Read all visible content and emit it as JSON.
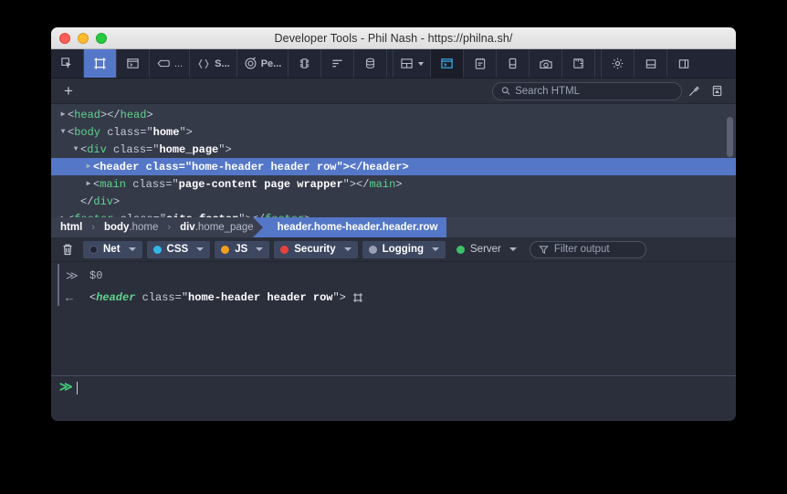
{
  "window": {
    "title": "Developer Tools - Phil Nash - https://philna.sh/",
    "traffic_lights": [
      "close",
      "minimize",
      "zoom"
    ]
  },
  "toolbar": {
    "items": [
      {
        "name": "picker-icon",
        "label": "",
        "state": "normal"
      },
      {
        "name": "inspector-icon",
        "label": "",
        "state": "selected"
      },
      {
        "name": "console-panel-icon",
        "label": "",
        "state": "normal"
      },
      {
        "name": "debugger-icon",
        "label": "...",
        "state": "normal"
      },
      {
        "name": "style-editor-icon",
        "label": "S...",
        "state": "normal"
      },
      {
        "name": "performance-icon",
        "label": "Pe...",
        "state": "normal"
      },
      {
        "name": "memory-icon",
        "label": "",
        "state": "normal"
      },
      {
        "name": "network-icon",
        "label": "",
        "state": "normal"
      },
      {
        "name": "storage-icon",
        "label": "",
        "state": "normal"
      },
      {
        "name": "layout-split-icon",
        "label": "",
        "state": "normal"
      },
      {
        "name": "toggle-console-icon",
        "label": "",
        "state": "active"
      },
      {
        "name": "notes-icon",
        "label": "",
        "state": "normal"
      },
      {
        "name": "responsive-mode-icon",
        "label": "",
        "state": "normal"
      },
      {
        "name": "screenshot-icon",
        "label": "",
        "state": "normal"
      },
      {
        "name": "measure-icon",
        "label": "",
        "state": "normal"
      },
      {
        "name": "settings-gear-icon",
        "label": "",
        "state": "normal"
      },
      {
        "name": "dock-bottom-icon",
        "label": "",
        "state": "normal"
      },
      {
        "name": "dock-side-icon",
        "label": "",
        "state": "normal"
      }
    ]
  },
  "subbar": {
    "add_node_label": "+",
    "search_placeholder": "Search HTML",
    "search_value": "",
    "eyedropper_icon": "eyedropper-icon",
    "archive_icon": "archive-icon"
  },
  "dom_tree": {
    "rows": [
      {
        "indent": 0,
        "twisty": "closed",
        "selected": false,
        "parts": [
          {
            "t": "punct",
            "v": "<"
          },
          {
            "t": "tag",
            "v": "head"
          },
          {
            "t": "punct",
            "v": "></"
          },
          {
            "t": "tag",
            "v": "head"
          },
          {
            "t": "punct",
            "v": ">"
          }
        ]
      },
      {
        "indent": 0,
        "twisty": "open",
        "selected": false,
        "parts": [
          {
            "t": "punct",
            "v": "<"
          },
          {
            "t": "tag",
            "v": "body"
          },
          {
            "t": "attr",
            "v": " class="
          },
          {
            "t": "punct",
            "v": "\""
          },
          {
            "t": "val",
            "v": "home"
          },
          {
            "t": "punct",
            "v": "\">"
          }
        ]
      },
      {
        "indent": 1,
        "twisty": "open",
        "selected": false,
        "parts": [
          {
            "t": "punct",
            "v": "<"
          },
          {
            "t": "tag",
            "v": "div"
          },
          {
            "t": "attr",
            "v": " class="
          },
          {
            "t": "punct",
            "v": "\""
          },
          {
            "t": "val",
            "v": "home_page"
          },
          {
            "t": "punct",
            "v": "\">"
          }
        ]
      },
      {
        "indent": 2,
        "twisty": "closed",
        "selected": true,
        "parts": [
          {
            "t": "punct",
            "v": "<"
          },
          {
            "t": "tag",
            "v": "header"
          },
          {
            "t": "attr",
            "v": " class="
          },
          {
            "t": "punct",
            "v": "\""
          },
          {
            "t": "val",
            "v": "home-header header row"
          },
          {
            "t": "punct",
            "v": "\"></"
          },
          {
            "t": "tag",
            "v": "header"
          },
          {
            "t": "punct",
            "v": ">"
          }
        ]
      },
      {
        "indent": 2,
        "twisty": "closed",
        "selected": false,
        "parts": [
          {
            "t": "punct",
            "v": "<"
          },
          {
            "t": "tag",
            "v": "main"
          },
          {
            "t": "attr",
            "v": " class="
          },
          {
            "t": "punct",
            "v": "\""
          },
          {
            "t": "val",
            "v": "page-content page wrapper"
          },
          {
            "t": "punct",
            "v": "\"></"
          },
          {
            "t": "tag",
            "v": "main"
          },
          {
            "t": "punct",
            "v": ">"
          }
        ]
      },
      {
        "indent": 1,
        "twisty": "none",
        "selected": false,
        "parts": [
          {
            "t": "punct",
            "v": "</"
          },
          {
            "t": "tag",
            "v": "div"
          },
          {
            "t": "punct",
            "v": ">"
          }
        ]
      },
      {
        "indent": 0,
        "twisty": "closed",
        "selected": false,
        "parts": [
          {
            "t": "punct",
            "v": "<"
          },
          {
            "t": "tag",
            "v": "footer"
          },
          {
            "t": "attr",
            "v": " class="
          },
          {
            "t": "punct",
            "v": "\""
          },
          {
            "t": "val",
            "v": "site-footer"
          },
          {
            "t": "punct",
            "v": "\"></"
          },
          {
            "t": "tag",
            "v": "footer"
          },
          {
            "t": "punct",
            "v": ">"
          }
        ]
      }
    ]
  },
  "breadcrumb": {
    "items": [
      {
        "tag": "html",
        "cls": "",
        "active": false
      },
      {
        "tag": "body",
        "cls": ".home",
        "active": false
      },
      {
        "tag": "div",
        "cls": ".home_page",
        "active": false
      },
      {
        "tag": "header",
        "cls": ".home-header.header.row",
        "active": true
      }
    ],
    "separator": "›"
  },
  "console_filters": {
    "trash_icon": "trash-icon",
    "pills": [
      {
        "label": "Net",
        "color": "#1f2430",
        "on": true,
        "caret": true
      },
      {
        "label": "CSS",
        "color": "#32b6e8",
        "on": true,
        "caret": true
      },
      {
        "label": "JS",
        "color": "#f0a01e",
        "on": true,
        "caret": true
      },
      {
        "label": "Security",
        "color": "#e8413c",
        "on": true,
        "caret": true
      },
      {
        "label": "Logging",
        "color": "#9aa1b3",
        "on": true,
        "caret": true
      },
      {
        "label": "Server",
        "color": "#3ec06a",
        "on": false,
        "caret": true
      }
    ],
    "filter_placeholder": "Filter output",
    "filter_value": "",
    "filter_icon": "funnel-icon"
  },
  "console_output": {
    "rows": [
      {
        "kind": "input",
        "gutter": "≫",
        "parts": [
          {
            "t": "in",
            "v": "$0"
          }
        ]
      },
      {
        "kind": "result",
        "gutter": "←",
        "parts": [
          {
            "t": "angle",
            "v": "<"
          },
          {
            "t": "tagname",
            "v": "header"
          },
          {
            "t": "attr",
            "v": " class="
          },
          {
            "t": "angle",
            "v": "\""
          },
          {
            "t": "val",
            "v": "home-header header row"
          },
          {
            "t": "angle",
            "v": "\">"
          }
        ],
        "trailing_icon": "inspect-node-icon"
      }
    ]
  },
  "console_input": {
    "prompt": "≫",
    "value": "",
    "placeholder": ""
  }
}
